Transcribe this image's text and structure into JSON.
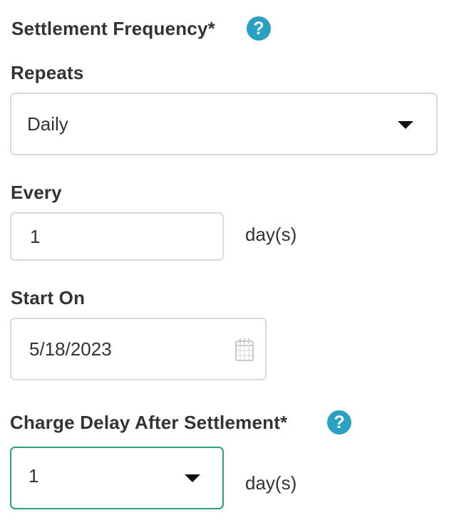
{
  "settlement_frequency": {
    "label": "Settlement Frequency*",
    "help_icon": "question-circle-icon",
    "help_glyph": "?"
  },
  "repeats": {
    "label": "Repeats",
    "selected": "Daily",
    "dropdown_icon": "caret-down-icon"
  },
  "every": {
    "label": "Every",
    "value": "1",
    "unit": "day(s)"
  },
  "start_on": {
    "label": "Start On",
    "value": "5/18/2023",
    "calendar_icon": "calendar-icon"
  },
  "charge_delay": {
    "label": "Charge Delay After Settlement*",
    "help_icon": "question-circle-icon",
    "help_glyph": "?",
    "selected": "1",
    "unit": "day(s)",
    "dropdown_icon": "caret-down-icon"
  },
  "colors": {
    "help_icon": "#2aa0c2",
    "focused_border": "#2e9e7e",
    "border": "#d9d9d9",
    "text": "#333333"
  }
}
